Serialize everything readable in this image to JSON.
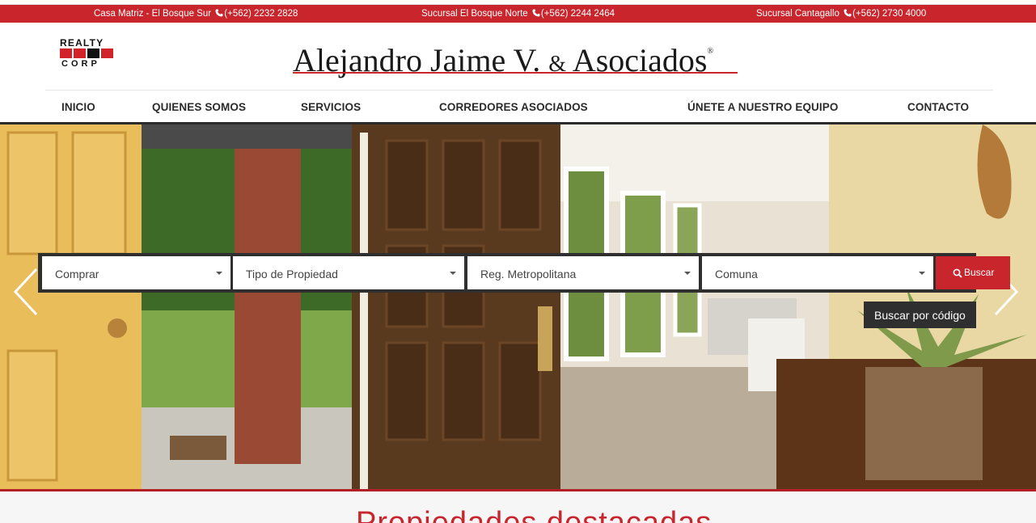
{
  "topbar": {
    "locations": [
      {
        "name": "Casa Matriz - El Bosque Sur",
        "phone": "(+562) 2232 2828"
      },
      {
        "name": "Sucursal El Bosque Norte",
        "phone": "(+562) 2244 2464"
      },
      {
        "name": "Sucursal Cantagallo",
        "phone": "(+562) 2730 4000"
      }
    ],
    "icon": "phone-icon"
  },
  "logo": {
    "top_text": "REALTY",
    "bottom_text": "CORP"
  },
  "brand": {
    "name_part1": "Alejandro Jaime V.",
    "ampersand": "&",
    "name_part2": "Asociados",
    "registered": "®"
  },
  "nav": {
    "items": [
      {
        "label": "INICIO"
      },
      {
        "label": "QUIENES SOMOS"
      },
      {
        "label": "SERVICIOS"
      },
      {
        "label": "CORREDORES ASOCIADOS"
      },
      {
        "label": "ÚNETE A NUESTRO EQUIPO"
      },
      {
        "label": "CONTACTO"
      }
    ]
  },
  "search": {
    "operation": "Comprar",
    "property_type": "Tipo de Propiedad",
    "region": "Reg. Metropolitana",
    "commune": "Comuna",
    "button_label": "Buscar",
    "code_label": "Buscar por código"
  },
  "featured": {
    "title": "Propiedades destacadas"
  },
  "colors": {
    "brand_red": "#c8252c",
    "dark": "#2f2f2f"
  }
}
